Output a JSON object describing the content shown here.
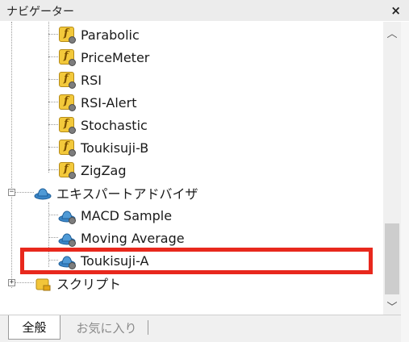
{
  "window": {
    "title": "ナビゲーター",
    "close_glyph": "×"
  },
  "tree": {
    "indicators": [
      {
        "label": "Parabolic",
        "icon": "custom-indicator-icon"
      },
      {
        "label": "PriceMeter",
        "icon": "custom-indicator-icon"
      },
      {
        "label": "RSI",
        "icon": "custom-indicator-icon"
      },
      {
        "label": "RSI-Alert",
        "icon": "custom-indicator-icon"
      },
      {
        "label": "Stochastic",
        "icon": "custom-indicator-icon"
      },
      {
        "label": "Toukisuji-B",
        "icon": "custom-indicator-icon"
      },
      {
        "label": "ZigZag",
        "icon": "custom-indicator-icon"
      }
    ],
    "expert_advisors": {
      "label": "エキスパートアドバイザ",
      "expander": "−",
      "icon": "expert-advisor-icon",
      "items": [
        {
          "label": "MACD Sample",
          "icon": "expert-advisor-icon"
        },
        {
          "label": "Moving Average",
          "icon": "expert-advisor-icon"
        },
        {
          "label": "Toukisuji-A",
          "icon": "expert-advisor-icon",
          "highlighted": true
        }
      ]
    },
    "scripts": {
      "label": "スクリプト",
      "expander": "+",
      "icon": "script-icon"
    }
  },
  "scrollbar": {
    "up_glyph": "︿",
    "down_glyph": "﹀"
  },
  "tabs": [
    {
      "label": "全般",
      "active": true
    },
    {
      "label": "お気に入り",
      "active": false
    }
  ],
  "colors": {
    "highlight_box": "#e8281d",
    "indicator_icon": "#f3c93b",
    "hat_blue": "#3a86c8"
  }
}
